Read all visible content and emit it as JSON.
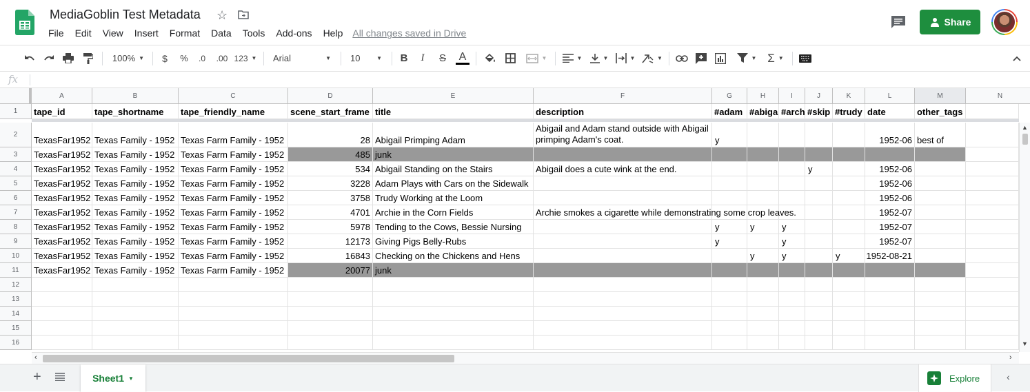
{
  "app": {
    "title": "MediaGoblin Test Metadata",
    "saved_status": "All changes saved in Drive",
    "share_label": "Share"
  },
  "menu": [
    "File",
    "Edit",
    "View",
    "Insert",
    "Format",
    "Data",
    "Tools",
    "Add-ons",
    "Help"
  ],
  "toolbar": {
    "zoom": "100%",
    "currency": "$",
    "percent": "%",
    "dec_decrease": ".0",
    "dec_increase": ".00",
    "more_formats": "123",
    "font": "Arial",
    "font_size": "10",
    "bold": "B",
    "italic": "I",
    "strike": "S",
    "text_color": "A"
  },
  "formula": {
    "fx": "fx",
    "value": ""
  },
  "columns": [
    "A",
    "B",
    "C",
    "D",
    "E",
    "F",
    "G",
    "H",
    "I",
    "J",
    "K",
    "L",
    "M",
    "N"
  ],
  "rows": [
    {
      "num": "1",
      "cells": [
        "tape_id",
        "tape_shortname",
        "tape_friendly_name",
        "scene_start_frame",
        "title",
        "description",
        "#adam",
        "#abiga",
        "#arch",
        "#skip",
        "#trudy",
        "date",
        "other_tags"
      ]
    },
    {
      "num": "2",
      "cells": [
        "TexasFar1952",
        "Texas Family - 1952",
        "Texas Farm Family - 1952",
        "28",
        "Abigail Primping Adam",
        "Abigail and Adam stand outside with Abigail primping Adam's coat.",
        "y",
        "",
        "",
        "",
        "",
        "1952-06",
        "best of"
      ]
    },
    {
      "num": "3",
      "cells": [
        "TexasFar1952",
        "Texas Family - 1952",
        "Texas Farm Family - 1952",
        "485",
        "junk",
        "",
        "",
        "",
        "",
        "",
        "",
        "",
        ""
      ]
    },
    {
      "num": "4",
      "cells": [
        "TexasFar1952",
        "Texas Family - 1952",
        "Texas Farm Family - 1952",
        "534",
        "Abigail Standing on the Stairs",
        "Abigail does a cute wink at the end.",
        "",
        "",
        "",
        "y",
        "",
        "1952-06",
        ""
      ]
    },
    {
      "num": "5",
      "cells": [
        "TexasFar1952",
        "Texas Family - 1952",
        "Texas Farm Family - 1952",
        "3228",
        "Adam Plays with Cars on the Sidewalk",
        "",
        "",
        "",
        "",
        "",
        "",
        "1952-06",
        ""
      ]
    },
    {
      "num": "6",
      "cells": [
        "TexasFar1952",
        "Texas Family - 1952",
        "Texas Farm Family - 1952",
        "3758",
        "Trudy Working at the Loom",
        "",
        "",
        "",
        "",
        "",
        "",
        "1952-06",
        ""
      ]
    },
    {
      "num": "7",
      "cells": [
        "TexasFar1952",
        "Texas Family - 1952",
        "Texas Farm Family - 1952",
        "4701",
        "Archie in the Corn Fields",
        "Archie smokes a cigarette while demonstrating some crop leaves.",
        "",
        "",
        "",
        "",
        "",
        "1952-07",
        ""
      ]
    },
    {
      "num": "8",
      "cells": [
        "TexasFar1952",
        "Texas Family - 1952",
        "Texas Farm Family - 1952",
        "5978",
        "Tending to the Cows, Bessie Nursing",
        "",
        "y",
        "y",
        "y",
        "",
        "",
        "1952-07",
        ""
      ]
    },
    {
      "num": "9",
      "cells": [
        "TexasFar1952",
        "Texas Family - 1952",
        "Texas Farm Family - 1952",
        "12173",
        "Giving Pigs Belly-Rubs",
        "",
        "y",
        "",
        "y",
        "",
        "",
        "1952-07",
        ""
      ]
    },
    {
      "num": "10",
      "cells": [
        "TexasFar1952",
        "Texas Family - 1952",
        "Texas Farm Family - 1952",
        "16843",
        "Checking on the Chickens and Hens",
        "",
        "",
        "y",
        "y",
        "",
        "y",
        "1952-08-21",
        ""
      ]
    },
    {
      "num": "11",
      "cells": [
        "TexasFar1952",
        "Texas Family - 1952",
        "Texas Farm Family - 1952",
        "20077",
        "junk",
        "",
        "",
        "",
        "",
        "",
        "",
        "",
        ""
      ]
    },
    {
      "num": "12",
      "cells": []
    },
    {
      "num": "13",
      "cells": []
    },
    {
      "num": "14",
      "cells": []
    },
    {
      "num": "15",
      "cells": []
    },
    {
      "num": "16",
      "cells": []
    }
  ],
  "sheets": [
    {
      "name": "Sheet1",
      "active": true
    }
  ],
  "explore_label": "Explore",
  "colors": {
    "brand_green": "#1e8e3e",
    "junk_row": "#999999"
  }
}
